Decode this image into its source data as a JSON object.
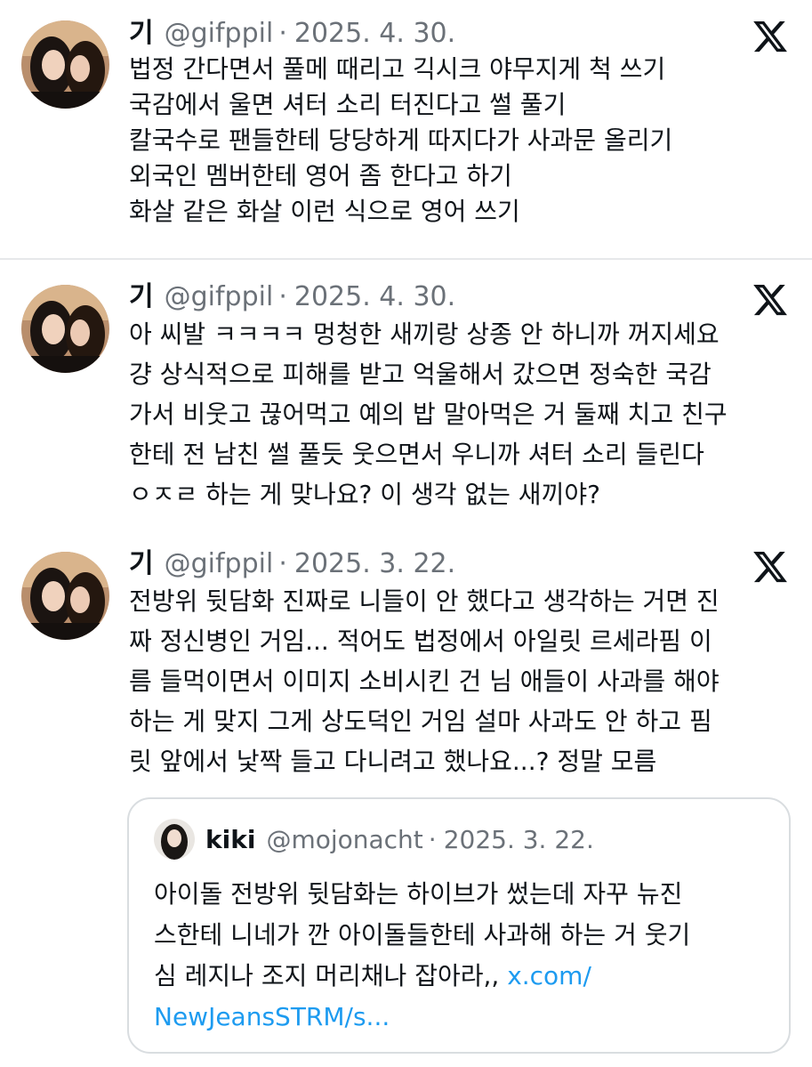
{
  "tweets": [
    {
      "name": "기",
      "handle": "@gifppil",
      "dot": "·",
      "date": "2025. 4. 30.",
      "lines": [
        "법정 간다면서 풀메 때리고 긱시크 야무지게 척 쓰기",
        "국감에서 울면 셔터 소리 터진다고 썰 풀기",
        "칼국수로 팬들한테 당당하게 따지다가 사과문 올리기",
        "외국인 멤버한테 영어 좀 한다고 하기",
        "화살 같은 화살 이런 식으로 영어 쓰기"
      ]
    },
    {
      "name": "기",
      "handle": "@gifppil",
      "dot": "·",
      "date": "2025. 4. 30.",
      "lines": [
        "아 씨발 ㅋㅋㅋㅋ 멍청한 새끼랑 상종 안 하니까 꺼지세요",
        "걍 상식적으로 피해를 받고 억울해서 갔으면 정숙한 국감",
        "가서 비웃고 끊어먹고 예의 밥 말아먹은 거 둘째 치고 친구",
        "한테 전 남친 썰 풀듯 웃으면서 우니까 셔터 소리 들린다",
        "ㅇㅈㄹ 하는 게 맞나요? 이 생각 없는 새끼야?"
      ]
    },
    {
      "name": "기",
      "handle": "@gifppil",
      "dot": "·",
      "date": "2025. 3. 22.",
      "lines": [
        "전방위 뒷담화 진짜로 니들이 안 했다고 생각하는 거면 진",
        "짜 정신병인 거임... 적어도 법정에서 아일릿 르세라핌 이",
        "름 들먹이면서 이미지 소비시킨 건 님 애들이 사과를 해야",
        "하는 게 맞지 그게 상도덕인 거임 설마 사과도 안 하고 핌",
        "릿 앞에서 낯짝 들고 다니려고 했나요...? 정말 모름"
      ]
    }
  ],
  "quote": {
    "name": "kiki",
    "handle": "@mojonacht",
    "dot": "·",
    "date": "2025. 3. 22.",
    "lines": [
      "아이돌 전방위 뒷담화는 하이브가 썼는데 자꾸 뉴진",
      "스한테 니네가 깐 아이돌들한테 사과해 하는 거 웃기",
      "심 레지나 조지 머리채나 잡아라,, "
    ],
    "link_part1": "x.com/",
    "link_part2": "NewJeansSTRM/s..."
  },
  "colors": {
    "text": "#0f1419",
    "muted": "#6b7178",
    "link": "#1d9bf0",
    "divider": "#e6e8ea"
  },
  "icons": [
    "x-logo-icon",
    "avatar-photo"
  ]
}
